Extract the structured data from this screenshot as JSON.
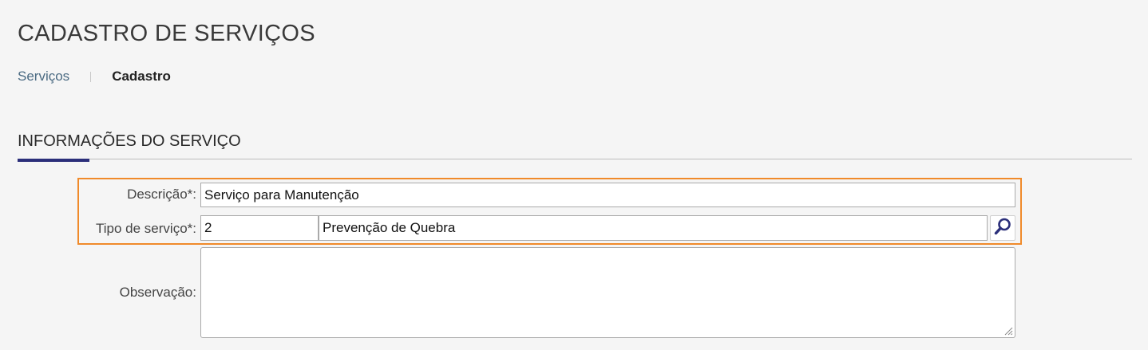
{
  "header": {
    "title": "CADASTRO DE SERVIÇOS"
  },
  "breadcrumb": {
    "link": "Serviços",
    "current": "Cadastro"
  },
  "section": {
    "title": "INFORMAÇÕES DO SERVIÇO"
  },
  "form": {
    "descricao": {
      "label": "Descrição*:",
      "value": "Serviço para Manutenção"
    },
    "tipo_servico": {
      "label": "Tipo de serviço*:",
      "code": "2",
      "description": "Prevenção de Quebra",
      "search_icon": "magnifier-icon"
    },
    "observacao": {
      "label": "Observação:",
      "value": ""
    }
  },
  "colors": {
    "highlight": "#f08a2a",
    "accent": "#2b2f7a",
    "link": "#4a6a82"
  }
}
